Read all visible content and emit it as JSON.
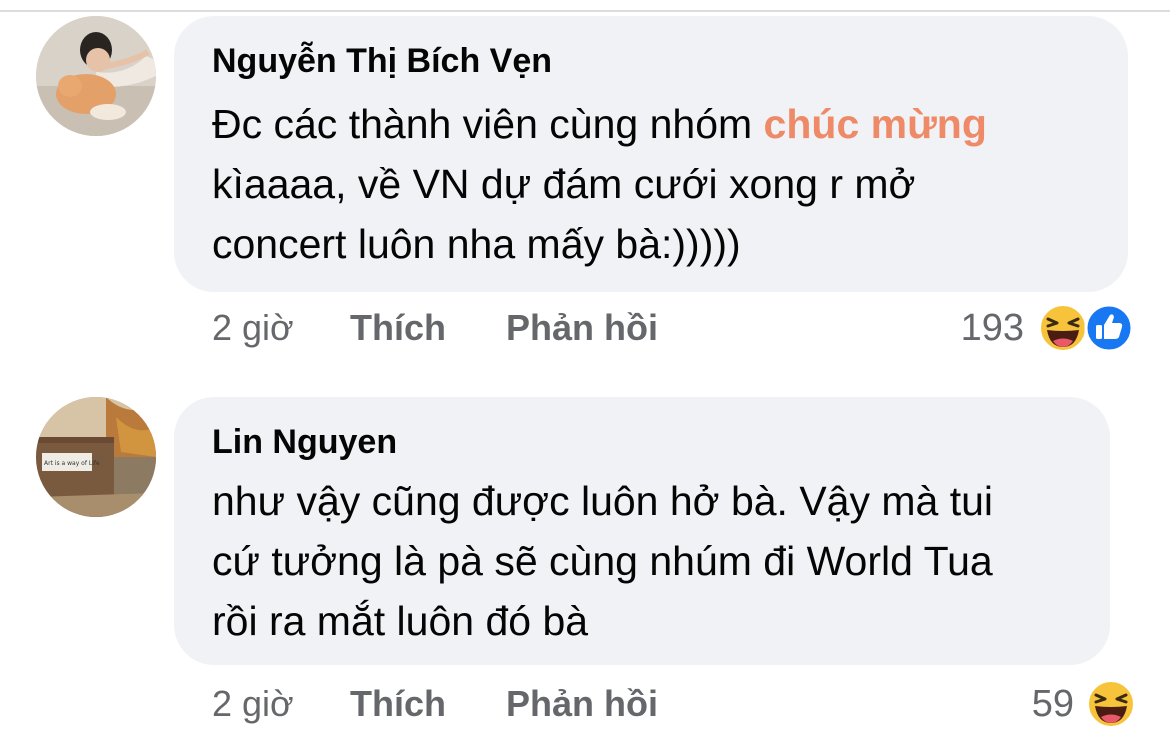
{
  "comments": [
    {
      "author": "Nguyễn Thị Bích Vẹn",
      "text_line1_pre": "Đc các thành viên cùng nhóm ",
      "text_line1_highlight": "chúc mừng",
      "text_line2": "kìaaaa, về VN dự đám cưới xong r mở",
      "text_line3": "concert luôn nha mấy bà:)))))",
      "time": "2 giờ",
      "like_label": "Thích",
      "reply_label": "Phản hồi",
      "reaction_count": "193",
      "reactions": [
        "haha-icon",
        "like-icon"
      ],
      "highlight_color": "#ee8a67"
    },
    {
      "author": "Lin Nguyen",
      "text_line1": "như vậy cũng được luôn hở bà. Vậy mà tui",
      "text_line2": "cứ tưởng là pà sẽ cùng nhúm đi World Tua",
      "text_line3": "rồi ra mắt luôn đó bà",
      "avatar_sign_text": "Art is a way of Life",
      "time": "2 giờ",
      "like_label": "Thích",
      "reply_label": "Phản hồi",
      "reaction_count": "59",
      "reactions": [
        "haha-icon"
      ]
    }
  ]
}
